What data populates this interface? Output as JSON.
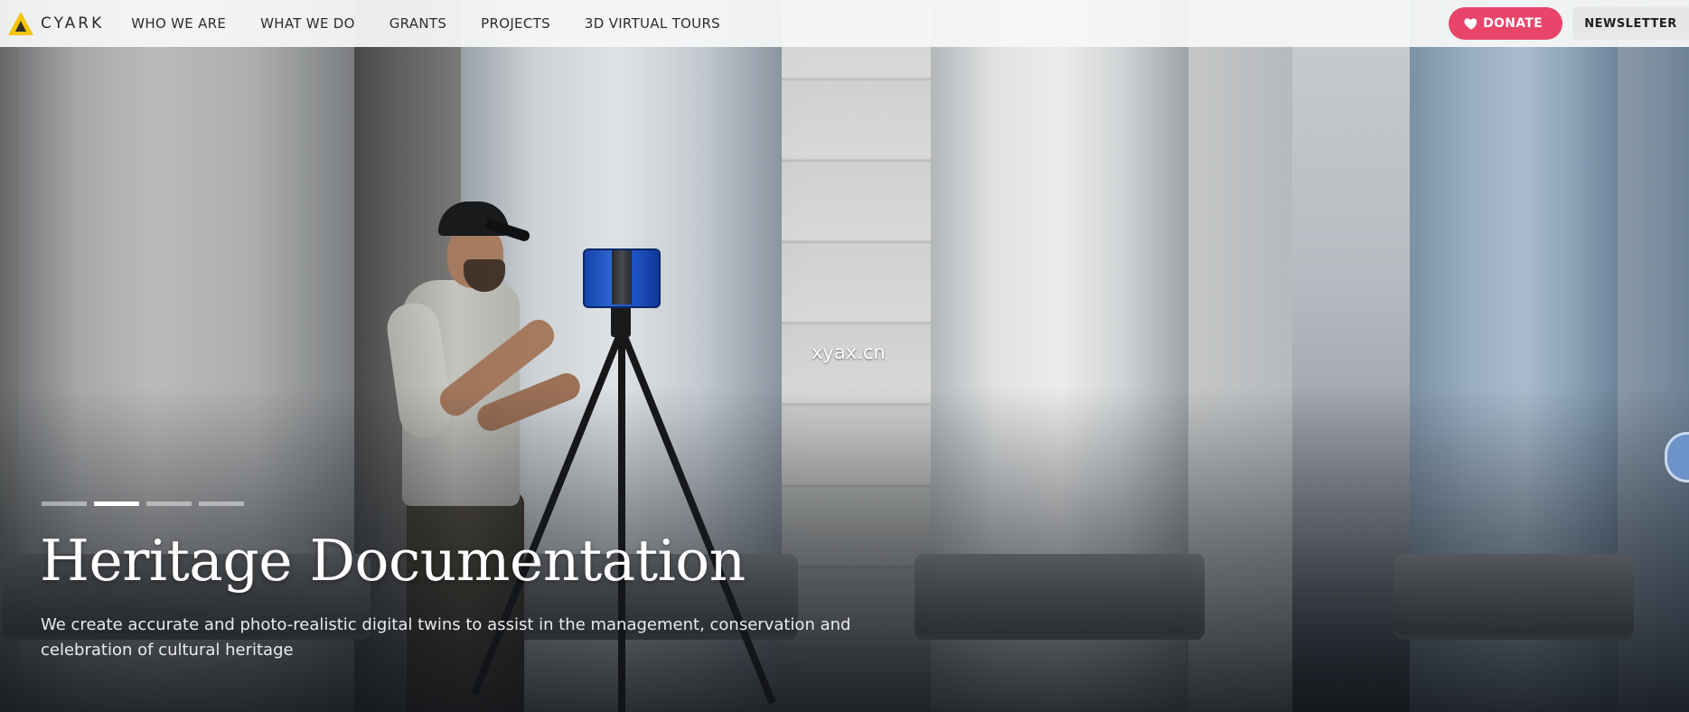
{
  "header": {
    "logo_text": "CYARK",
    "nav": [
      {
        "label": "WHO WE ARE"
      },
      {
        "label": "WHAT WE DO"
      },
      {
        "label": "GRANTS"
      },
      {
        "label": "PROJECTS"
      },
      {
        "label": "3D VIRTUAL TOURS"
      }
    ],
    "donate_label": "DONATE",
    "newsletter_label": "NEWSLETTER"
  },
  "hero": {
    "title": "Heritage Documentation",
    "description": "We create accurate and photo-realistic digital twins to assist in the management, conservation and celebration of cultural heritage",
    "slides_total": 4,
    "active_slide_index": 1
  },
  "watermark_text": "xyax.cn",
  "colors": {
    "donate": "#e9446a",
    "logo_yellow": "#f5c400",
    "scanner_blue": "#2f6be0"
  },
  "icons": {
    "donate": "heart-icon",
    "logo": "cyark-logo-icon"
  }
}
